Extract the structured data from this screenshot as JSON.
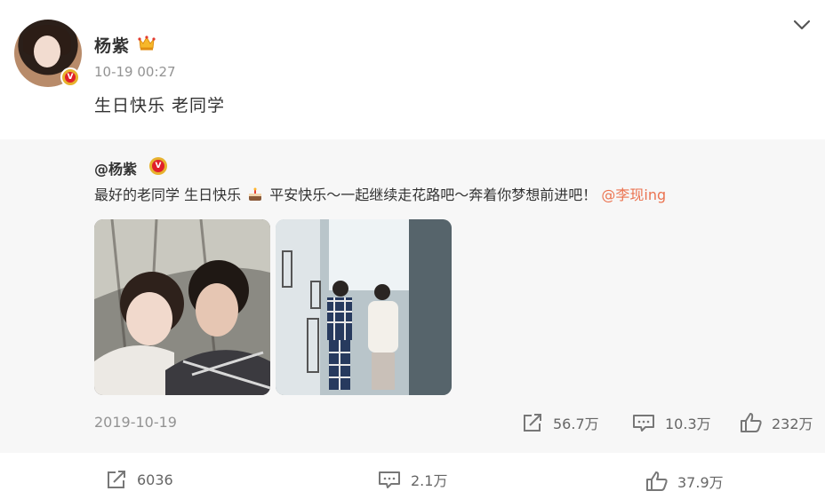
{
  "post": {
    "author": "杨紫",
    "timestamp": "10-19 00:27",
    "text": "生日快乐 老同学"
  },
  "repost": {
    "author": "@杨紫",
    "text_before": "最好的老同学 生日快乐",
    "text_after": "平安快乐～一起继续走花路吧～奔着你梦想前进吧！",
    "mention": "@李现ing",
    "date": "2019-10-19",
    "share_count": "56.7万",
    "comment_count": "10.3万",
    "like_count": "232万"
  },
  "footer": {
    "share_count": "6036",
    "comment_count": "2.1万",
    "like_count": "37.9万"
  },
  "icons": {
    "crown": "crown-icon",
    "verified": "verified-badge",
    "more": "chevron-down-icon",
    "cake": "cake-emoji",
    "share": "share-icon",
    "comment": "comment-icon",
    "like": "like-icon"
  },
  "colors": {
    "mention": "#eb7350",
    "muted": "#939393",
    "repost_bg": "#f7f7f7",
    "badge_red": "#e01f2a",
    "badge_gold": "#e7b22e"
  }
}
